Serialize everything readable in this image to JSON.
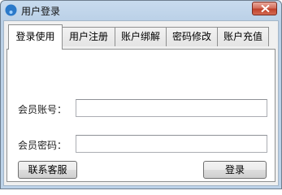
{
  "window": {
    "title": "用户登录"
  },
  "tabs": [
    {
      "label": "登录使用",
      "active": true
    },
    {
      "label": "用户注册",
      "active": false
    },
    {
      "label": "账户绑解",
      "active": false
    },
    {
      "label": "密码修改",
      "active": false
    },
    {
      "label": "账户充值",
      "active": false
    }
  ],
  "login_form": {
    "account_label": "会员账号：",
    "account_value": "",
    "password_label": "会员密码：",
    "password_value": "",
    "contact_button": "联系客服",
    "login_button": "登录"
  },
  "icons": {
    "app": "app-logo-icon",
    "close": "close-icon"
  }
}
